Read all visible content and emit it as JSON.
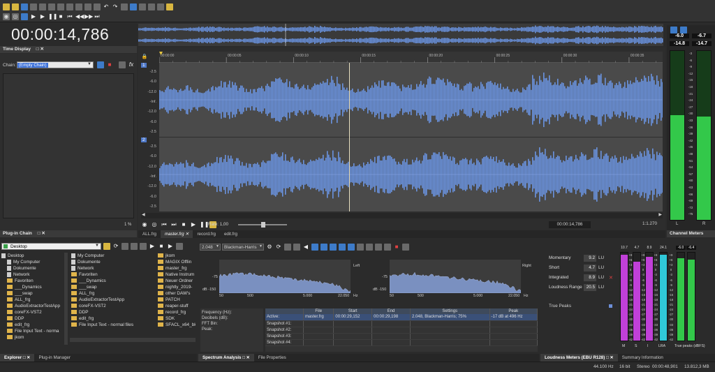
{
  "colors": {
    "accent": "#6d8fd8",
    "waveform": "#6a93e0",
    "meter_green": "#33c84a",
    "meter_magenta": "#c040d8",
    "meter_cyan": "#30c8d8"
  },
  "time_display": {
    "time": "00:00:14,786",
    "title": "Time Display"
  },
  "plugin_chain": {
    "title": "Plug-in Chain",
    "chain_label": "Chain:",
    "chain_value": "(Empty Chain)",
    "zoom_pct": "1 %"
  },
  "timeline": {
    "ticks": [
      "00:00:00",
      "00:00:05",
      "00:00:10",
      "00:00:15",
      "00:00:20",
      "00:00:25",
      "00:00:30",
      "00:00:35"
    ],
    "db_labels_1": [
      "-2.5",
      "-6.0",
      "-12.0",
      "-Inf.",
      "-12.0",
      "-6.0",
      "-2.5"
    ],
    "db_labels_2": [
      "-2.5",
      "-6.0",
      "-12.0",
      "-Inf.",
      "-12.0",
      "-6.0",
      "-2.5"
    ],
    "rate_label": "Rate: 1,00",
    "position": "00:00:14,786",
    "zoom": "1:1.270",
    "ch1": "1",
    "ch2": "2"
  },
  "file_tabs": [
    "ALL.frg",
    "master.frg",
    "record.frg",
    "edit.frg"
  ],
  "channel_meters": {
    "title": "Channel Meters",
    "peak_l": "-6.0",
    "peak_r": "-6.7",
    "rms_l": "-14.8",
    "rms_r": "-14.7",
    "scale": [
      "-3",
      "-6",
      "-9",
      "-12",
      "-15",
      "-18",
      "-21",
      "-24",
      "-27",
      "-30",
      "-33",
      "-36",
      "-39",
      "-42",
      "-45",
      "-48",
      "-51",
      "-54",
      "-57",
      "-60",
      "-63",
      "-66",
      "-69",
      "-72",
      "-75"
    ],
    "label_l": "L",
    "label_r": "R",
    "level_l": 0.62,
    "level_r": 0.61
  },
  "explorer": {
    "title": "Explorer",
    "tab2": "Plug-in Manager",
    "location": "Desktop",
    "tree": [
      "Desktop",
      "My Computer",
      "Dokumente",
      "Network",
      "Favoriten",
      "___Dynamics",
      "___swap",
      "ALL_frg",
      "AudioExtractorTestApp",
      "coreFX-VST2",
      "DDP",
      "edit_frg",
      "File Input Text - norma",
      "jkom"
    ],
    "col2": [
      "My Computer",
      "Dokumente",
      "Network",
      "Favoriten",
      "___Dynamics",
      "___swap",
      "ALL_frg",
      "AudioExtractorTestApp",
      "coreFX-VST2",
      "DDP",
      "edit_frg",
      "File Input Text - normal files"
    ],
    "col3": [
      "jkom",
      "MAGIX Offlin",
      "master_frg",
      "Native Instrum",
      "Neuer Ordner",
      "nightly_2019-",
      "other DAW's",
      "PATCH",
      "reaper-stuff",
      "record_frg",
      "SDK",
      "SFACL_x64_bk"
    ]
  },
  "spectrum": {
    "title": "Spectrum Analysis",
    "tab2": "File Properties",
    "fft": "2.048",
    "window": "Blackman-Harris",
    "left": "Left",
    "right": "Right",
    "db_top": "dB -150",
    "freq_labels": [
      "50",
      "500",
      "5.000",
      "22.050"
    ],
    "hz": "Hz",
    "db_mid": "-75",
    "info_labels": [
      "Frequency (Hz):",
      "Decibels (dB):",
      "FFT Bin:",
      "Peak:"
    ],
    "table_headers": [
      "",
      "File",
      "Start",
      "End",
      "Settings",
      "Peak"
    ],
    "rows": [
      [
        "Active:",
        "master.frg",
        "00:00:29,152",
        "00:00:29,198",
        "2.048, Blackman-Harris; 75%",
        "-17 dB at 496 Hz"
      ],
      [
        "Snapshot #1:",
        "",
        "",
        "",
        "",
        ""
      ],
      [
        "Snapshot #2:",
        "",
        "",
        "",
        "",
        ""
      ],
      [
        "Snapshot #3:",
        "",
        "",
        "",
        "",
        ""
      ],
      [
        "Snapshot #4:",
        "",
        "",
        "",
        "",
        ""
      ]
    ]
  },
  "loudness": {
    "title": "Loudness Meters (EBU R128)",
    "tab2": "Summary Information",
    "rows": [
      {
        "label": "Momentary",
        "value": "9.2",
        "unit": "LU"
      },
      {
        "label": "Short",
        "value": "4.7",
        "unit": "LU"
      },
      {
        "label": "Integrated",
        "value": "8.9",
        "unit": "LU"
      },
      {
        "label": "Loudness Range",
        "value": "20.5",
        "unit": "LU"
      }
    ],
    "true_peaks": "True Peaks",
    "bar_tops": [
      "10.7",
      "4.7",
      "8.9",
      "24.1",
      "-6.0",
      "-6.4"
    ],
    "bar_labels": [
      "M",
      "S",
      "I",
      "LRA",
      "True peaks (dBFS)"
    ],
    "scale": [
      "+9",
      "+6",
      "+3",
      "0",
      "-3",
      "-6",
      "-9",
      "-12",
      "-15",
      "-18",
      "-21",
      "-24",
      "-27",
      "-30",
      "-33",
      "-36",
      "-39",
      "-42"
    ],
    "levels": [
      0.98,
      0.9,
      0.95,
      0.98,
      0.94,
      0.92
    ]
  },
  "status": {
    "rate": "44.100 Hz",
    "bits": "16 bit",
    "chan": "Stereo",
    "length": "00:00:48,901",
    "size": "13.812,3 MB"
  }
}
